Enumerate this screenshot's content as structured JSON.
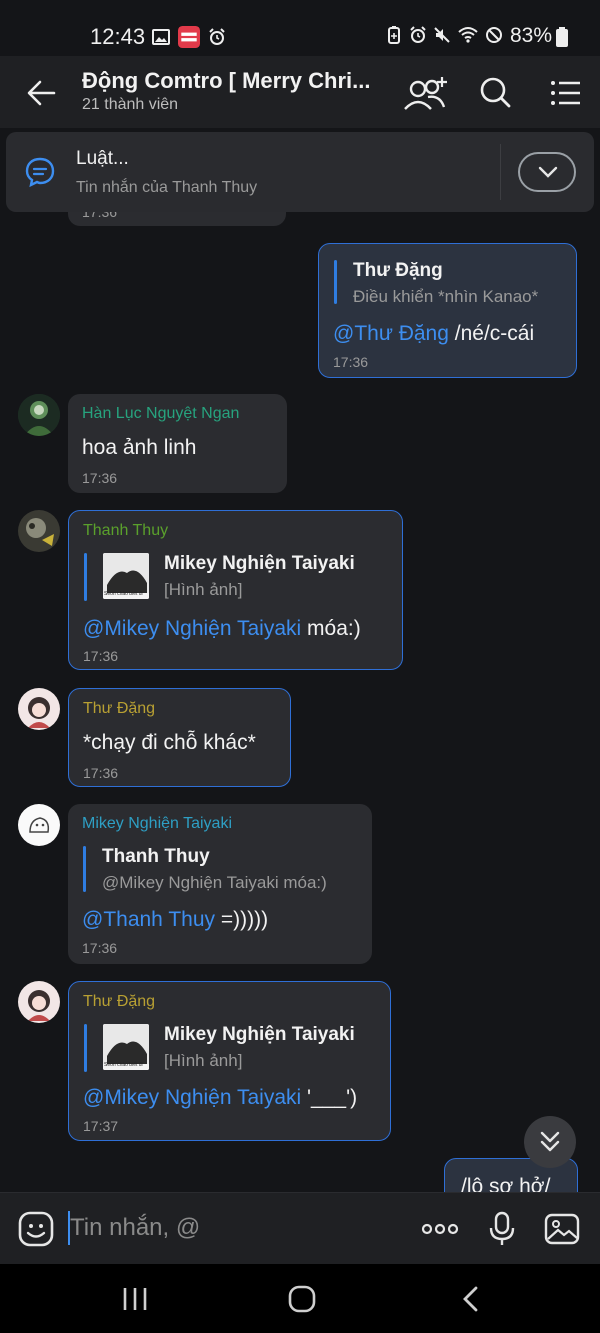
{
  "status": {
    "time": "12:43",
    "battery": "83%"
  },
  "header": {
    "title": "Động Comtro [ Merry Chri...",
    "subtitle": "21 thành viên"
  },
  "pinned": {
    "title": "Luật...",
    "subtitle": "Tin nhắn của Thanh Thuy"
  },
  "partial_time": "17:36",
  "messages": [
    {
      "id": "m1",
      "quote_name": "Thư Đặng",
      "quote_text": "Điều khiển *nhìn Kanao*",
      "mention": "@Thư Đặng",
      "text": " /né/c-cái",
      "time": "17:36"
    },
    {
      "id": "m2",
      "sender": "Hàn Lục Nguyệt Ngan",
      "sender_color": "#27a37e",
      "text": "hoa ảnh linh",
      "time": "17:36"
    },
    {
      "id": "m3",
      "sender": "Thanh Thuy",
      "sender_color": "#5aa02c",
      "quote_name": "Mikey Nghiện Taiyaki",
      "quote_text": "[Hình ảnh]",
      "thumb_caption": "Seon chào biết đi",
      "mention": "@Mikey Nghiện Taiyaki",
      "text": " móa:)",
      "time": "17:36"
    },
    {
      "id": "m4",
      "sender": "Thư Đặng",
      "sender_color": "#b8a033",
      "text": "*chạy đi chỗ khác*",
      "time": "17:36"
    },
    {
      "id": "m5",
      "sender": "Mikey Nghiện Taiyaki",
      "sender_color": "#2e9fc4",
      "quote_name": "Thanh Thuy",
      "quote_text": "@Mikey Nghiện Taiyaki móa:)",
      "mention": "@Thanh Thuy",
      "text": " =)))))",
      "time": "17:36"
    },
    {
      "id": "m6",
      "sender": "Thư Đặng",
      "sender_color": "#b8a033",
      "quote_name": "Mikey Nghiện Taiyaki",
      "quote_text": "[Hình ảnh]",
      "thumb_caption": "Seon chào biết đi",
      "mention": "@Mikey Nghiện Taiyaki",
      "text": " '___')",
      "time": "17:37"
    },
    {
      "id": "m7",
      "text": "/lộ sợ hở/"
    }
  ],
  "input": {
    "placeholder": "Tin nhắn, @"
  },
  "colors": {
    "accent": "#3d8ef0",
    "bg": "#141518",
    "bubble": "#2b2c30"
  }
}
